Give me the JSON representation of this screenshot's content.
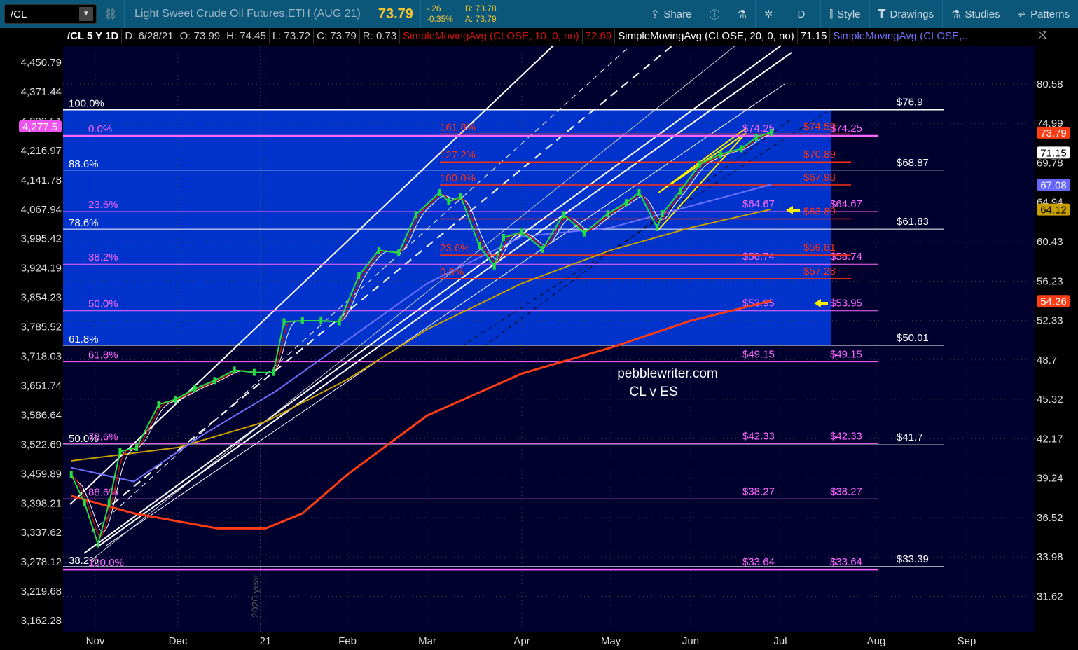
{
  "toolbar": {
    "symbol": "/CL",
    "description": "Light Sweet Crude Oil Futures,ETH (AUG 21)",
    "last": "73.79",
    "change": "-.26",
    "change_pct": "-0.35%",
    "bid": "B: 73.78",
    "ask": "A: 73.79",
    "buttons": [
      {
        "label": "Share",
        "icon": "share-icon"
      },
      {
        "label": "",
        "icon": "info-icon"
      },
      {
        "label": "",
        "icon": "flask-icon"
      },
      {
        "label": "",
        "icon": "gear-icon"
      },
      {
        "label": "D",
        "icon": ""
      },
      {
        "label": "Style",
        "icon": "candle-icon"
      },
      {
        "label": "Drawings",
        "icon": "text-t-icon"
      },
      {
        "label": "Studies",
        "icon": "flask-icon"
      },
      {
        "label": "Patterns",
        "icon": "patterns-icon"
      }
    ]
  },
  "header": {
    "title": "/CL 5 Y 1D",
    "date": "D: 6/28/21",
    "open": "O: 73.99",
    "high": "H: 74.45",
    "low": "L: 73.72",
    "close": "C: 73.79",
    "range": "R: 0.73",
    "sma10": "SimpleMovingAvg (CLOSE, 10, 0, no)",
    "sma10_val": "72.69",
    "sma20": "SimpleMovingAvg (CLOSE, 20, 0, no)",
    "sma20_val": "71.15",
    "sma50": "SimpleMovingAvg (CLOSE,..."
  },
  "chart_data": {
    "type": "line",
    "scale": "log",
    "background": "#00002e",
    "highlight_color": "#0033cc",
    "right_axis_ticks": [
      80.58,
      74.99,
      69.78,
      64.94,
      60.43,
      56.23,
      52.33,
      48.7,
      45.32,
      42.17,
      39.24,
      36.52,
      33.98,
      31.62
    ],
    "left_axis_ticks": [
      "4,450.79",
      "4,371.44",
      "4,293.51",
      "4,216.97",
      "4,141.78",
      "4,067.94",
      "3,995.42",
      "3,924.19",
      "3,854.23",
      "3,785.52",
      "3,718.03",
      "3,651.74",
      "3,586.64",
      "3,522.69",
      "3,459.89",
      "3,398.21",
      "3,337.62",
      "3,278.12",
      "3,219.68",
      "3,162.28"
    ],
    "left_badge": {
      "label": "4,277.5",
      "color": "#ee55ee"
    },
    "x_labels": [
      "Nov",
      "Dec",
      "21",
      "Feb",
      "Mar",
      "Apr",
      "May",
      "Jun",
      "Jul",
      "Aug",
      "Sep"
    ],
    "year_marker": "2020 year",
    "badges": [
      {
        "value": "73.79",
        "price": 73.79,
        "bg": "#ff3c14",
        "fg": "#fff"
      },
      {
        "value": "71.15",
        "price": 71.15,
        "bg": "#fff",
        "fg": "#000"
      },
      {
        "value": "67.08",
        "price": 67.08,
        "bg": "#6666ff",
        "fg": "#fff"
      },
      {
        "value": "64.12",
        "price": 64.12,
        "bg": "#c8a000",
        "fg": "#000"
      },
      {
        "value": "54.26",
        "price": 54.26,
        "bg": "#ff3c14",
        "fg": "#fff"
      }
    ],
    "close": [
      [
        "2020-10-23",
        39.5
      ],
      [
        "2020-10-28",
        37.5
      ],
      [
        "2020-11-02",
        34.8
      ],
      [
        "2020-11-06",
        37.5
      ],
      [
        "2020-11-10",
        41.2
      ],
      [
        "2020-11-16",
        41.5
      ],
      [
        "2020-11-24",
        44.9
      ],
      [
        "2020-11-30",
        45.3
      ],
      [
        "2020-12-07",
        46.2
      ],
      [
        "2020-12-14",
        46.9
      ],
      [
        "2020-12-21",
        47.8
      ],
      [
        "2020-12-28",
        47.6
      ],
      [
        "2021-01-04",
        47.6
      ],
      [
        "2021-01-08",
        52.2
      ],
      [
        "2021-01-15",
        52.3
      ],
      [
        "2021-01-22",
        52.3
      ],
      [
        "2021-01-29",
        52.2
      ],
      [
        "2021-02-05",
        56.8
      ],
      [
        "2021-02-12",
        59.5
      ],
      [
        "2021-02-19",
        59.2
      ],
      [
        "2021-02-25",
        63.5
      ],
      [
        "2021-03-05",
        66.1
      ],
      [
        "2021-03-08",
        65.0
      ],
      [
        "2021-03-12",
        65.6
      ],
      [
        "2021-03-18",
        60.0
      ],
      [
        "2021-03-23",
        57.8
      ],
      [
        "2021-03-26",
        60.9
      ],
      [
        "2021-04-01",
        61.5
      ],
      [
        "2021-04-08",
        59.6
      ],
      [
        "2021-04-15",
        63.5
      ],
      [
        "2021-04-22",
        61.4
      ],
      [
        "2021-04-30",
        63.6
      ],
      [
        "2021-05-07",
        64.9
      ],
      [
        "2021-05-12",
        66.1
      ],
      [
        "2021-05-19",
        62.0
      ],
      [
        "2021-05-21",
        63.6
      ],
      [
        "2021-05-28",
        66.3
      ],
      [
        "2021-06-04",
        69.6
      ],
      [
        "2021-06-11",
        70.9
      ],
      [
        "2021-06-18",
        71.6
      ],
      [
        "2021-06-23",
        73.1
      ],
      [
        "2021-06-28",
        73.8
      ]
    ],
    "sma50": [
      [
        "2020-10-23",
        40.0
      ],
      [
        "2020-11-15",
        39.0
      ],
      [
        "2020-12-10",
        42.5
      ],
      [
        "2021-01-05",
        46
      ],
      [
        "2021-02-01",
        50.5
      ],
      [
        "2021-03-01",
        56
      ],
      [
        "2021-04-01",
        61
      ],
      [
        "2021-05-01",
        62
      ],
      [
        "2021-06-01",
        64.5
      ],
      [
        "2021-06-28",
        67.08
      ]
    ],
    "sma100": [
      [
        "2020-10-23",
        40.5
      ],
      [
        "2020-12-01",
        41.5
      ],
      [
        "2021-01-01",
        43.5
      ],
      [
        "2021-02-01",
        47
      ],
      [
        "2021-03-01",
        51.5
      ],
      [
        "2021-04-01",
        56
      ],
      [
        "2021-05-01",
        59.5
      ],
      [
        "2021-06-01",
        62
      ],
      [
        "2021-06-28",
        64.12
      ]
    ],
    "sma200": [
      [
        "2020-10-23",
        38
      ],
      [
        "2020-11-15",
        36.8
      ],
      [
        "2020-12-15",
        35.8
      ],
      [
        "2021-01-01",
        35.8
      ],
      [
        "2021-01-15",
        36.8
      ],
      [
        "2021-02-01",
        39.5
      ],
      [
        "2021-03-01",
        44
      ],
      [
        "2021-04-01",
        47.5
      ],
      [
        "2021-05-01",
        49.8
      ],
      [
        "2021-06-01",
        52.3
      ],
      [
        "2021-06-28",
        54.26
      ]
    ],
    "white_levels": [
      {
        "price": 76.9,
        "pct": "100.0%",
        "label": "$76.9"
      },
      {
        "price": 68.87,
        "pct": "88.6%",
        "label": "$68.87"
      },
      {
        "price": 61.83,
        "pct": "78.6%",
        "label": "$61.83"
      },
      {
        "price": 50.01,
        "pct": "61.8%",
        "label": "$50.01"
      },
      {
        "price": 41.7,
        "pct": "50.0%",
        "label": "$41.7"
      },
      {
        "price": 33.39,
        "pct": "38.2%",
        "label": "$33.39"
      }
    ],
    "magenta_levels": [
      {
        "price": 74.25,
        "pct": "0.0%",
        "label": "$74.25"
      },
      {
        "price": 64.67,
        "pct": "23.6%",
        "label": "$64.67"
      },
      {
        "price": 58.74,
        "pct": "38.2%",
        "label": "$58.74"
      },
      {
        "price": 53.95,
        "pct": "50.0%",
        "label": "$53.95"
      },
      {
        "price": 49.15,
        "pct": "61.8%",
        "label": "$49.15"
      },
      {
        "price": 42.33,
        "pct": "78.6%",
        "label": "$42.33"
      },
      {
        "price": 38.27,
        "pct": "88.6%",
        "label": "$38.27"
      },
      {
        "price": 33.64,
        "pct": "100.0%",
        "label": "$33.64"
      }
    ],
    "red_levels": [
      {
        "price": 74.59,
        "pct": "161.8%",
        "label": "$74.59"
      },
      {
        "price": 70.89,
        "pct": "127.2%",
        "label": "$70.89"
      },
      {
        "price": 67.98,
        "pct": "100.0%",
        "label": "$67.98"
      },
      {
        "price": 63.89,
        "pct": "",
        "label": "$63.89"
      },
      {
        "price": 59.81,
        "pct": "23.6%",
        "label": "$59.81"
      },
      {
        "price": 57.28,
        "pct": "0.0%",
        "label": "$57.28"
      }
    ],
    "watermark": [
      "pebblewriter.com",
      "CL v ES"
    ]
  }
}
